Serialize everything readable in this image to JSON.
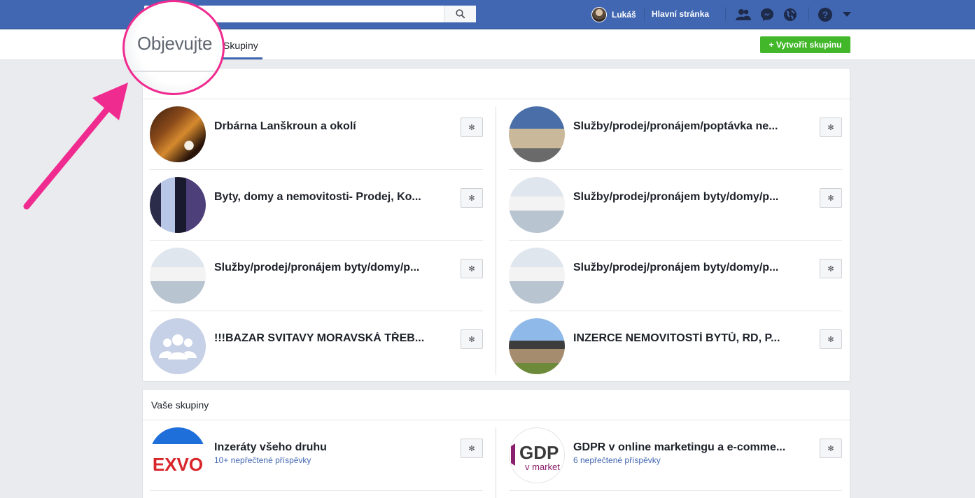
{
  "topbar": {
    "search_placeholder": "",
    "user_name": "Lukáš",
    "home_label": "Hlavní stránka"
  },
  "subbar": {
    "tab_label": "Skupiny",
    "create_label": "+ Vytvořit skupinu"
  },
  "annotation": {
    "zoom_text": "Objevujte"
  },
  "section_discover": {
    "title": "",
    "items": [
      {
        "title": "Drbárna Lanškroun a okolí",
        "thumb": "t-drb"
      },
      {
        "title": "Služby/prodej/pronájem/poptávka ne...",
        "thumb": "t-church"
      },
      {
        "title": "Byty, domy a nemovitosti- Prodej, Ko...",
        "thumb": "t-byty"
      },
      {
        "title": "Služby/prodej/pronájem byty/domy/p...",
        "thumb": "t-room"
      },
      {
        "title": "Služby/prodej/pronájem byty/domy/p...",
        "thumb": "t-room"
      },
      {
        "title": "Služby/prodej/pronájem byty/domy/p...",
        "thumb": "t-room"
      },
      {
        "title": "!!!BAZAR SVITAVY MORAVSKÁ TŘEB...",
        "thumb": "t-bazar"
      },
      {
        "title": "INZERCE NEMOVITOSTÍ BYTŮ, RD, P...",
        "thumb": "t-house"
      }
    ]
  },
  "section_yours": {
    "title": "Vaše skupiny",
    "items": [
      {
        "title": "Inzeráty všeho druhu",
        "sub": "10+ nepřečtené příspěvky",
        "thumb": "t-exvo"
      },
      {
        "title": "GDPR v online marketingu a e-comme...",
        "sub": "6 nepřečtené příspěvky",
        "thumb": "t-gdpr"
      }
    ]
  },
  "colors": {
    "brand": "#4267b2",
    "create_green": "#42b72a",
    "annotation_pink": "#f02b8f"
  }
}
